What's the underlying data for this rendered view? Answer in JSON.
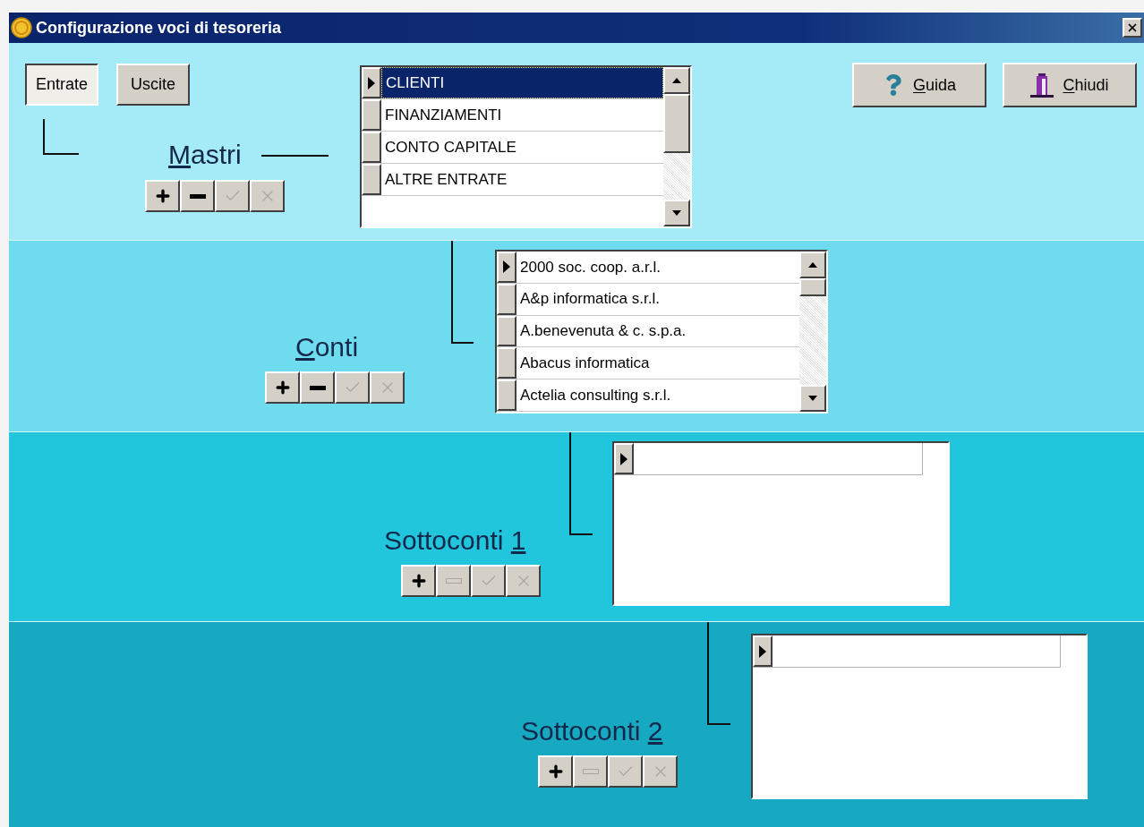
{
  "window": {
    "title": "Configurazione voci di tesoreria"
  },
  "mode_buttons": [
    {
      "label": "Entrate",
      "selected": true
    },
    {
      "label": "Uscite",
      "selected": false
    }
  ],
  "action_buttons": [
    {
      "kind": "help",
      "label": [
        {
          "text": "G",
          "underlined": true
        },
        {
          "text": "uida",
          "underlined": false
        }
      ]
    },
    {
      "kind": "exit",
      "label": [
        {
          "text": "C",
          "underlined": true
        },
        {
          "text": "hiudi",
          "underlined": false
        }
      ]
    }
  ],
  "levels": [
    {
      "label": [
        {
          "text": "M",
          "underlined": true
        },
        {
          "text": "astri",
          "underlined": false
        }
      ],
      "tools": [
        {
          "kind": "add",
          "disabled": false
        },
        {
          "kind": "remove",
          "disabled": false
        },
        {
          "kind": "confirm",
          "disabled": true
        },
        {
          "kind": "cancel",
          "disabled": true
        }
      ],
      "grid": {
        "scrollbar": true,
        "rows": [
          {
            "text": "CLIENTI",
            "current": true,
            "selected": true
          },
          {
            "text": "FINANZIAMENTI",
            "current": false,
            "selected": false
          },
          {
            "text": "CONTO CAPITALE",
            "current": false,
            "selected": false
          },
          {
            "text": "ALTRE ENTRATE",
            "current": false,
            "selected": false
          }
        ]
      }
    },
    {
      "label": [
        {
          "text": "C",
          "underlined": true
        },
        {
          "text": "onti",
          "underlined": false
        }
      ],
      "tools": [
        {
          "kind": "add",
          "disabled": false
        },
        {
          "kind": "remove",
          "disabled": false
        },
        {
          "kind": "confirm",
          "disabled": true
        },
        {
          "kind": "cancel",
          "disabled": true
        }
      ],
      "grid": {
        "scrollbar": true,
        "rows": [
          {
            "text": "2000 soc. coop. a.r.l.",
            "current": true,
            "selected": false
          },
          {
            "text": "A&p informatica s.r.l.",
            "current": false,
            "selected": false
          },
          {
            "text": "A.benevenuta & c. s.p.a.",
            "current": false,
            "selected": false
          },
          {
            "text": "Abacus informatica",
            "current": false,
            "selected": false
          },
          {
            "text": "Actelia consulting s.r.l.",
            "current": false,
            "selected": false
          }
        ]
      }
    },
    {
      "label": [
        {
          "text": "Sottoconti ",
          "underlined": false
        },
        {
          "text": "1",
          "underlined": true
        }
      ],
      "tools": [
        {
          "kind": "add",
          "disabled": false
        },
        {
          "kind": "remove",
          "disabled": true
        },
        {
          "kind": "confirm",
          "disabled": true
        },
        {
          "kind": "cancel",
          "disabled": true
        }
      ],
      "grid": {
        "scrollbar": false,
        "new_row": {
          "current": true
        }
      }
    },
    {
      "label": [
        {
          "text": "Sottoconti ",
          "underlined": false
        },
        {
          "text": "2",
          "underlined": true
        }
      ],
      "tools": [
        {
          "kind": "add",
          "disabled": false
        },
        {
          "kind": "remove",
          "disabled": true
        },
        {
          "kind": "confirm",
          "disabled": true
        },
        {
          "kind": "cancel",
          "disabled": true
        }
      ],
      "grid": {
        "scrollbar": false,
        "new_row": {
          "current": true
        }
      }
    }
  ]
}
